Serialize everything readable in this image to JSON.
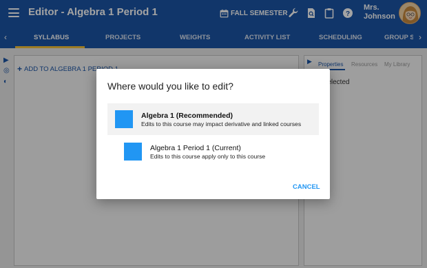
{
  "header": {
    "title": "Editor - Algebra 1 Period 1",
    "semester_label": "FALL SEMESTER",
    "user_name_line1": "Mrs.",
    "user_name_line2": "Johnson",
    "icons": [
      "menu-icon",
      "calendar-icon",
      "wrench-icon",
      "search-document-icon",
      "clipboard-icon",
      "help-icon"
    ]
  },
  "tabs": {
    "items": [
      "SYLLABUS",
      "PROJECTS",
      "WEIGHTS",
      "ACTIVITY LIST",
      "SCHEDULING",
      "GROUP SETTINGS"
    ],
    "active": "SYLLABUS"
  },
  "main": {
    "add_link": "ADD TO ALGEBRA 1 PERIOD 1"
  },
  "right_panel": {
    "tabs": [
      "Properties",
      "Resources",
      "My Library"
    ],
    "active_tab": "Properties",
    "partial_text": "n selected"
  },
  "dialog": {
    "title": "Where would you like to edit?",
    "options": [
      {
        "name": "Algebra 1 (Recommended)",
        "description": "Edits to this course may impact derivative and linked courses",
        "selected": true
      },
      {
        "name": "Algebra 1 Period 1 (Current)",
        "description": "Edits to this course apply only to this course",
        "selected": false
      }
    ],
    "cancel_label": "CANCEL"
  },
  "colors": {
    "header_blue": "#1c55a6",
    "accent_yellow": "#f5c33b",
    "option_blue": "#2196f3"
  }
}
